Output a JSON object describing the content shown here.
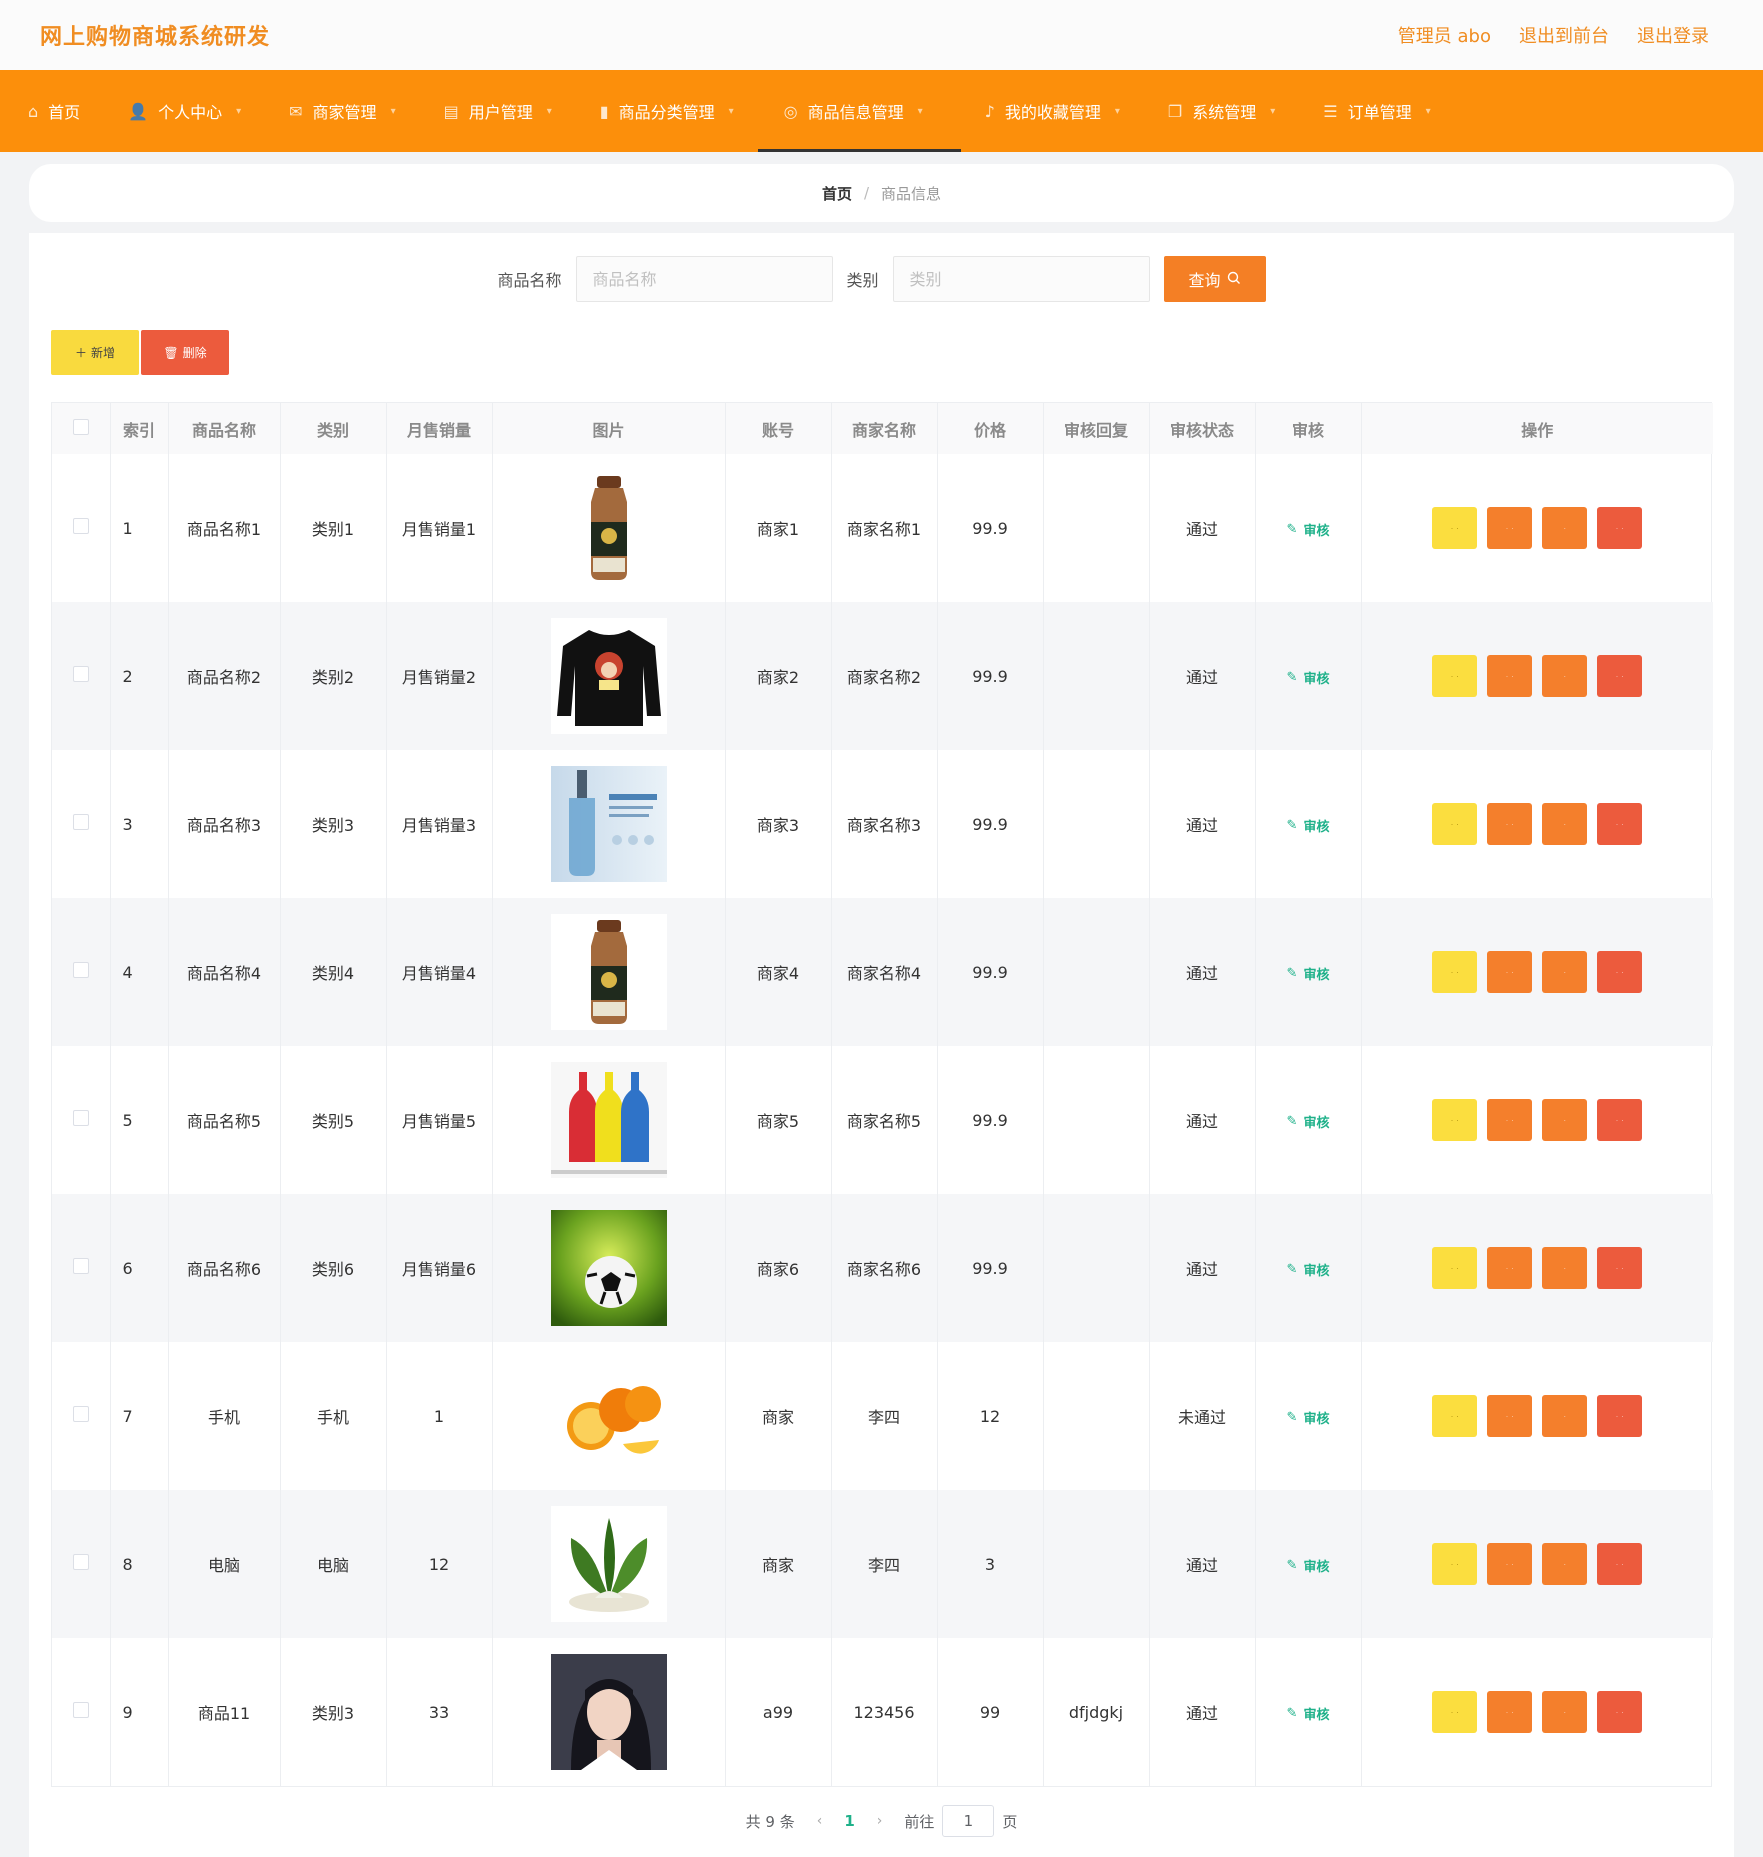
{
  "header": {
    "title": "网上购物商城系统研发",
    "links": [
      "管理员 abo",
      "退出到前台",
      "退出登录"
    ]
  },
  "nav": [
    {
      "label": "首页",
      "icon": "home-icon",
      "glyph": "⌂",
      "chevron": false
    },
    {
      "label": "个人中心",
      "icon": "user-icon",
      "glyph": "👤",
      "chevron": true
    },
    {
      "label": "商家管理",
      "icon": "mail-icon",
      "glyph": "✉",
      "chevron": true
    },
    {
      "label": "用户管理",
      "icon": "chat-icon",
      "glyph": "▤",
      "chevron": true
    },
    {
      "label": "商品分类管理",
      "icon": "bar-chart-icon",
      "glyph": "▮",
      "chevron": true
    },
    {
      "label": "商品信息管理",
      "icon": "globe-icon",
      "glyph": "◎",
      "chevron": true,
      "active": true
    },
    {
      "label": "我的收藏管理",
      "icon": "mic-icon",
      "glyph": "♪",
      "chevron": true
    },
    {
      "label": "系统管理",
      "icon": "window-icon",
      "glyph": "❐",
      "chevron": true
    },
    {
      "label": "订单管理",
      "icon": "list-icon",
      "glyph": "☰",
      "chevron": true
    }
  ],
  "breadcrumb": {
    "home": "首页",
    "separator": "/",
    "current": "商品信息"
  },
  "search": {
    "name_label": "商品名称",
    "name_placeholder": "商品名称",
    "category_label": "类别",
    "category_placeholder": "类别",
    "query_button": "查询"
  },
  "actions": {
    "add": "新增",
    "delete": "删除"
  },
  "table": {
    "columns": [
      "索引",
      "商品名称",
      "类别",
      "月售销量",
      "图片",
      "账号",
      "商家名称",
      "价格",
      "审核回复",
      "审核状态",
      "审核",
      "操作"
    ],
    "audit_label": "审核",
    "rows": [
      {
        "index": "1",
        "name": "商品名称1",
        "category": "类别1",
        "sales": "月售销量1",
        "image": "milk-bottle",
        "account": "商家1",
        "merchant": "商家名称1",
        "price": "99.9",
        "reply": "",
        "status": "通过"
      },
      {
        "index": "2",
        "name": "商品名称2",
        "category": "类别2",
        "sales": "月售销量2",
        "image": "black-sweater",
        "account": "商家2",
        "merchant": "商家名称2",
        "price": "99.9",
        "reply": "",
        "status": "通过"
      },
      {
        "index": "3",
        "name": "商品名称3",
        "category": "类别3",
        "sales": "月售销量3",
        "image": "serum-bottle",
        "account": "商家3",
        "merchant": "商家名称3",
        "price": "99.9",
        "reply": "",
        "status": "通过"
      },
      {
        "index": "4",
        "name": "商品名称4",
        "category": "类别4",
        "sales": "月售销量4",
        "image": "milk-bottle",
        "account": "商家4",
        "merchant": "商家名称4",
        "price": "99.9",
        "reply": "",
        "status": "通过"
      },
      {
        "index": "5",
        "name": "商品名称5",
        "category": "类别5",
        "sales": "月售销量5",
        "image": "color-bottles",
        "account": "商家5",
        "merchant": "商家名称5",
        "price": "99.9",
        "reply": "",
        "status": "通过"
      },
      {
        "index": "6",
        "name": "商品名称6",
        "category": "类别6",
        "sales": "月售销量6",
        "image": "soccer-ball",
        "account": "商家6",
        "merchant": "商家名称6",
        "price": "99.9",
        "reply": "",
        "status": "通过"
      },
      {
        "index": "7",
        "name": "手机",
        "category": "手机",
        "sales": "1",
        "image": "oranges",
        "account": "商家",
        "merchant": "李四",
        "price": "12",
        "reply": "",
        "status": "未通过"
      },
      {
        "index": "8",
        "name": "电脑",
        "category": "电脑",
        "sales": "12",
        "image": "bok-choy",
        "account": "商家",
        "merchant": "李四",
        "price": "3",
        "reply": "",
        "status": "通过"
      },
      {
        "index": "9",
        "name": "商品11",
        "category": "类别3",
        "sales": "33",
        "image": "portrait",
        "account": "a99",
        "merchant": "123456",
        "price": "99",
        "reply": "dfjdgkj",
        "status": "通过"
      }
    ]
  },
  "pagination": {
    "total": "共 9 条",
    "current": "1",
    "goto_prefix": "前往",
    "goto_value": "1",
    "goto_suffix": "页"
  },
  "colors": {
    "accent": "#fc8f0b",
    "title": "#f08d22",
    "audit": "#1fb18a",
    "danger": "#ec5b3d",
    "warn": "#fbde3f"
  }
}
